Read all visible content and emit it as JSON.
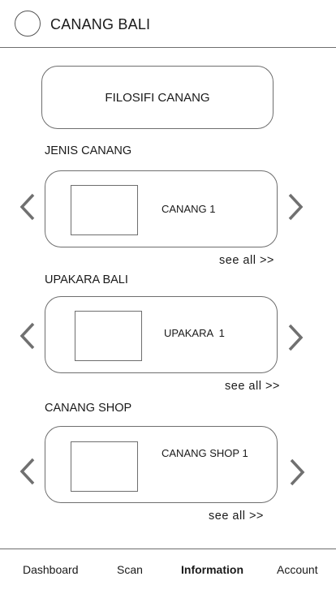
{
  "header": {
    "title": "CANANG BALI"
  },
  "filosofi": {
    "label": "FILOSIFI CANANG"
  },
  "sections": [
    {
      "title": "JENIS CANANG",
      "item_label": "CANANG 1",
      "see_all": "see all >>"
    },
    {
      "title": "UPAKARA BALI",
      "item_label": "UPAKARA  1",
      "see_all": "see all >>"
    },
    {
      "title": "CANANG SHOP",
      "item_label": "CANANG SHOP 1",
      "see_all": "see all >>"
    }
  ],
  "icons": {
    "prev": "chevron-left-icon",
    "next": "chevron-right-icon",
    "logo": "circle-logo-icon"
  },
  "nav": {
    "items": [
      "Dashboard",
      "Scan",
      "Information",
      "Account"
    ],
    "active": "Information"
  }
}
